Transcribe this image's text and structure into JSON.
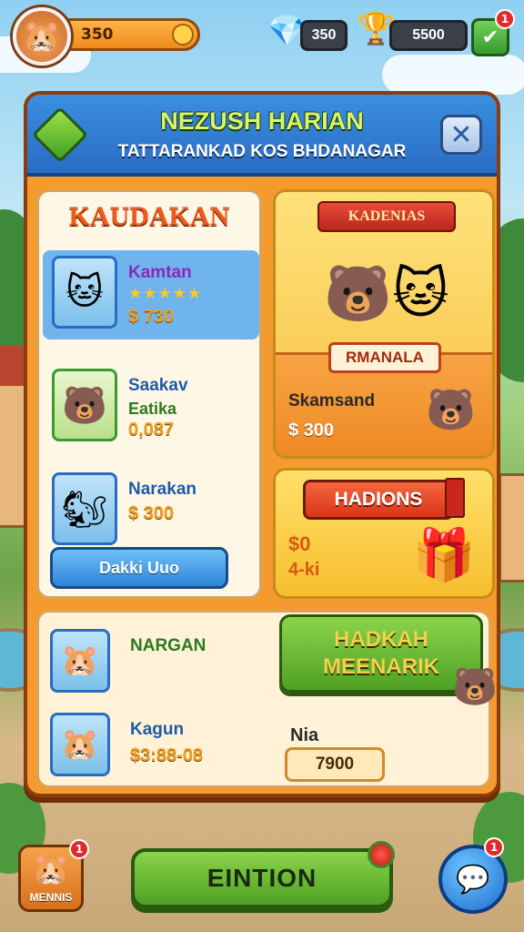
{
  "hud": {
    "coins": "350",
    "gems": "350",
    "gold": "5500",
    "notification_count": "1"
  },
  "panel": {
    "title": "NEZUSH HARIAN",
    "subtitle": "TATTARANKAD KOS BHDANAGAR"
  },
  "left_list": {
    "title": "KAUDAKAN",
    "items": [
      {
        "name": "Kamtan",
        "price": "$ 730",
        "stars": "★★★★★"
      },
      {
        "name": "Saakav",
        "sub": "Eatika",
        "price": "0,087"
      },
      {
        "name": "Narakan",
        "price": "$ 300"
      }
    ],
    "button": "Dakki Uuo"
  },
  "featured": {
    "ribbon": "KADENIAS",
    "label": "RMANALA",
    "name": "Skamsand",
    "price": "$ 300"
  },
  "card2": {
    "button": "HADIONS",
    "value1": "$0",
    "value2": "4-ki"
  },
  "bottom": {
    "items": [
      {
        "name": "NARGAN"
      },
      {
        "name": "Kagun",
        "price": "$3:88-08"
      }
    ],
    "green_button_line1": "HADKAH",
    "green_button_line2": "MEENARIK",
    "small_label": "Nia",
    "value": "7900"
  },
  "bottom_bar": {
    "menu_label": "MENNIS",
    "main_button": "EINTION",
    "menu_badge": "1",
    "round_badge": "1"
  }
}
